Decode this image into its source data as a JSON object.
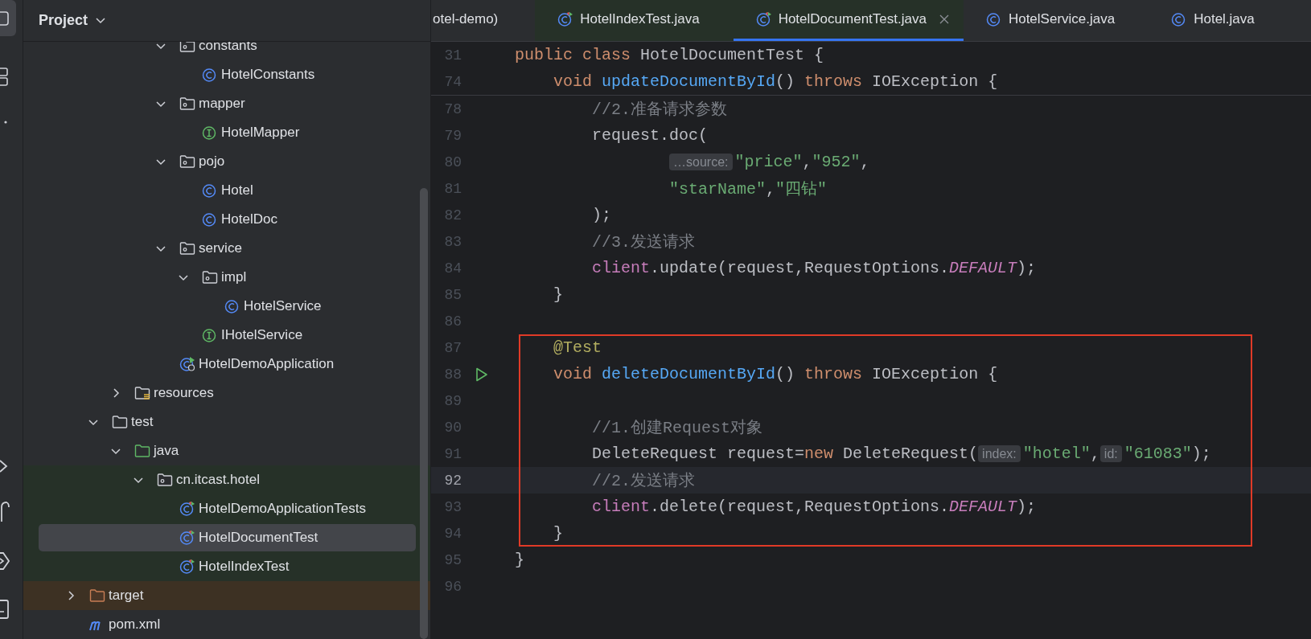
{
  "project_panel": {
    "title": "Project",
    "tree": [
      {
        "children": [
          {
            "children": [
              {
                "children": [
                  {
                    "children": [
                      {
                        "label": "constants",
                        "kind": "package",
                        "expanded": true,
                        "selected": false,
                        "children": [
                          {
                            "label": "HotelConstants",
                            "kind": "class",
                            "selected": false
                          }
                        ]
                      },
                      {
                        "label": "mapper",
                        "kind": "package",
                        "expanded": true,
                        "selected": false,
                        "children": [
                          {
                            "label": "HotelMapper",
                            "kind": "interface",
                            "selected": false
                          }
                        ]
                      },
                      {
                        "label": "pojo",
                        "kind": "package",
                        "expanded": true,
                        "selected": false,
                        "children": [
                          {
                            "label": "Hotel",
                            "kind": "class",
                            "selected": false
                          },
                          {
                            "label": "HotelDoc",
                            "kind": "class",
                            "selected": false
                          }
                        ]
                      },
                      {
                        "label": "service",
                        "kind": "package",
                        "expanded": true,
                        "selected": false,
                        "children": [
                          {
                            "label": "impl",
                            "kind": "package",
                            "expanded": true,
                            "selected": false,
                            "children": [
                              {
                                "label": "HotelService",
                                "kind": "class",
                                "selected": false
                              }
                            ]
                          },
                          {
                            "label": "IHotelService",
                            "kind": "interface",
                            "selected": false
                          }
                        ]
                      },
                      {
                        "label": "HotelDemoApplication",
                        "kind": "app",
                        "selected": false
                      }
                    ]
                  }
                ]
              },
              {
                "label": "resources",
                "kind": "resources",
                "expanded": false,
                "selected": false
              }
            ]
          },
          {
            "label": "test",
            "kind": "folder",
            "expanded": true,
            "selected": false,
            "children": [
              {
                "label": "java",
                "kind": "testroot",
                "expanded": true,
                "selected": false,
                "children": [
                  {
                    "label": "cn.itcast.hotel",
                    "kind": "package",
                    "expanded": true,
                    "selected": false,
                    "children": [
                      {
                        "label": "HotelDemoApplicationTests",
                        "kind": "test",
                        "selected": false
                      },
                      {
                        "label": "HotelDocumentTest",
                        "kind": "test",
                        "selected": true
                      },
                      {
                        "label": "HotelIndexTest",
                        "kind": "test",
                        "selected": false
                      }
                    ]
                  }
                ]
              }
            ]
          }
        ]
      },
      {
        "label": "target",
        "kind": "excluded",
        "expanded": false,
        "selected": false
      },
      {
        "label": "pom.xml",
        "kind": "maven",
        "selected": false
      }
    ]
  },
  "editor": {
    "tabs": [
      {
        "label": "otel-demo)",
        "kind": "plain",
        "selected": false
      },
      {
        "label": "HotelIndexTest.java",
        "kind": "test",
        "selected": false
      },
      {
        "label": "HotelDocumentTest.java",
        "kind": "test",
        "selected": true
      },
      {
        "label": "HotelService.java",
        "kind": "class",
        "selected": false
      },
      {
        "label": "Hotel.java",
        "kind": "class",
        "selected": false
      }
    ],
    "sticky_lines": [
      {
        "number": "31",
        "tokens": [
          {
            "kind": "keyword",
            "text": "public class "
          },
          {
            "kind": "plain",
            "text": "HotelDocumentTest {"
          }
        ]
      },
      {
        "number": "74",
        "tokens": [
          {
            "kind": "keyword",
            "text": "    void "
          },
          {
            "kind": "function",
            "text": "updateDocumentById"
          },
          {
            "kind": "plain",
            "text": "() "
          },
          {
            "kind": "keyword",
            "text": "throws "
          },
          {
            "kind": "plain",
            "text": "IOException {"
          }
        ]
      }
    ],
    "lines": [
      {
        "number": "78",
        "current": false,
        "boxed": false,
        "run": false,
        "tokens": [
          {
            "kind": "comment",
            "text": "        //2.准备请求参数"
          }
        ]
      },
      {
        "number": "79",
        "current": false,
        "boxed": false,
        "run": false,
        "tokens": [
          {
            "kind": "plain",
            "text": "        request.doc("
          }
        ]
      },
      {
        "number": "80",
        "current": false,
        "boxed": false,
        "run": false,
        "tokens": [
          {
            "kind": "hint",
            "text": "                …source:"
          },
          {
            "kind": "string",
            "text": "\"price\""
          },
          {
            "kind": "plain",
            "text": ","
          },
          {
            "kind": "string",
            "text": "\"952\""
          },
          {
            "kind": "plain",
            "text": ","
          }
        ]
      },
      {
        "number": "81",
        "current": false,
        "boxed": false,
        "run": false,
        "tokens": [
          {
            "kind": "string",
            "text": "                \"starName\""
          },
          {
            "kind": "plain",
            "text": ","
          },
          {
            "kind": "string",
            "text": "\"四钻\""
          }
        ]
      },
      {
        "number": "82",
        "current": false,
        "boxed": false,
        "run": false,
        "tokens": [
          {
            "kind": "plain",
            "text": "        );"
          }
        ]
      },
      {
        "number": "83",
        "current": false,
        "boxed": false,
        "run": false,
        "tokens": [
          {
            "kind": "comment",
            "text": "        //3.发送请求"
          }
        ]
      },
      {
        "number": "84",
        "current": false,
        "boxed": false,
        "run": false,
        "tokens": [
          {
            "kind": "field",
            "text": "        client"
          },
          {
            "kind": "plain",
            "text": ".update(request,RequestOptions."
          },
          {
            "kind": "constant",
            "text": "DEFAULT"
          },
          {
            "kind": "plain",
            "text": ");"
          }
        ]
      },
      {
        "number": "85",
        "current": false,
        "boxed": false,
        "run": false,
        "tokens": [
          {
            "kind": "plain",
            "text": "    }"
          }
        ]
      },
      {
        "number": "86",
        "current": false,
        "boxed": false,
        "run": false
      },
      {
        "number": "87",
        "current": false,
        "boxed": true,
        "run": false,
        "tokens": [
          {
            "kind": "annotation",
            "text": "    @Test"
          }
        ]
      },
      {
        "number": "88",
        "current": false,
        "boxed": true,
        "run": true,
        "tokens": [
          {
            "kind": "keyword",
            "text": "    void "
          },
          {
            "kind": "function",
            "text": "deleteDocumentById"
          },
          {
            "kind": "plain",
            "text": "() "
          },
          {
            "kind": "keyword",
            "text": "throws "
          },
          {
            "kind": "plain",
            "text": "IOException {"
          }
        ]
      },
      {
        "number": "89",
        "current": false,
        "boxed": true,
        "run": false
      },
      {
        "number": "90",
        "current": false,
        "boxed": true,
        "run": false,
        "tokens": [
          {
            "kind": "comment",
            "text": "        //1.创建Request对象"
          }
        ]
      },
      {
        "number": "91",
        "current": false,
        "boxed": true,
        "run": false,
        "tokens": [
          {
            "kind": "plain",
            "text": "        DeleteRequest request="
          },
          {
            "kind": "keyword",
            "text": "new "
          },
          {
            "kind": "plain",
            "text": "DeleteRequest("
          },
          {
            "kind": "hint",
            "text": "index:"
          },
          {
            "kind": "string",
            "text": "\"hotel\""
          },
          {
            "kind": "plain",
            "text": ","
          },
          {
            "kind": "hint",
            "text": "id:"
          },
          {
            "kind": "string",
            "text": "\"61083\""
          },
          {
            "kind": "plain",
            "text": ");"
          }
        ]
      },
      {
        "number": "92",
        "current": true,
        "boxed": true,
        "run": false,
        "tokens": [
          {
            "kind": "comment",
            "text": "        //2.发送请求"
          }
        ]
      },
      {
        "number": "93",
        "current": false,
        "boxed": true,
        "run": false,
        "tokens": [
          {
            "kind": "field",
            "text": "        client"
          },
          {
            "kind": "plain",
            "text": ".delete(request,RequestOptions."
          },
          {
            "kind": "constant",
            "text": "DEFAULT"
          },
          {
            "kind": "plain",
            "text": ");"
          }
        ]
      },
      {
        "number": "94",
        "current": false,
        "boxed": true,
        "run": false,
        "tokens": [
          {
            "kind": "plain",
            "text": "    }"
          }
        ]
      },
      {
        "number": "95",
        "current": false,
        "boxed": false,
        "run": false,
        "tokens": [
          {
            "kind": "plain",
            "text": "}"
          }
        ]
      },
      {
        "number": "96",
        "current": false,
        "boxed": false,
        "run": false
      }
    ]
  }
}
